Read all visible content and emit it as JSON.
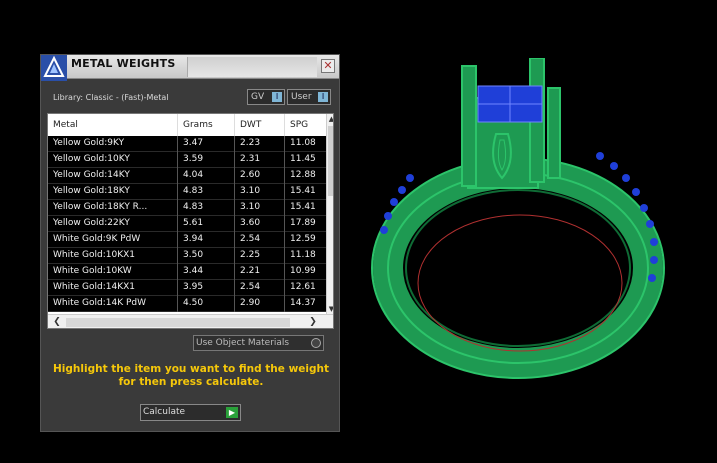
{
  "panel": {
    "title": "METAL WEIGHTS",
    "close_glyph": "✕",
    "library": "Library: Classic - (Fast)-Metal",
    "gv_label": "GV",
    "user_label": "User",
    "indicator_glyph": "I",
    "columns": [
      "Metal",
      "Grams",
      "DWT",
      "SPG"
    ],
    "rows": [
      [
        "Yellow Gold:9KY",
        "3.47",
        "2.23",
        "11.08"
      ],
      [
        "Yellow Gold:10KY",
        "3.59",
        "2.31",
        "11.45"
      ],
      [
        "Yellow Gold:14KY",
        "4.04",
        "2.60",
        "12.88"
      ],
      [
        "Yellow Gold:18KY",
        "4.83",
        "3.10",
        "15.41"
      ],
      [
        "Yellow Gold:18KY R...",
        "4.83",
        "3.10",
        "15.41"
      ],
      [
        "Yellow Gold:22KY",
        "5.61",
        "3.60",
        "17.89"
      ],
      [
        "White Gold:9K PdW",
        "3.94",
        "2.54",
        "12.59"
      ],
      [
        "White Gold:10KX1",
        "3.50",
        "2.25",
        "11.18"
      ],
      [
        "White Gold:10KW",
        "3.44",
        "2.21",
        "10.99"
      ],
      [
        "White Gold:14KX1",
        "3.95",
        "2.54",
        "12.61"
      ],
      [
        "White Gold:14K PdW",
        "4.50",
        "2.90",
        "14.37"
      ]
    ],
    "scroll_up": "▲",
    "scroll_down": "▼",
    "scroll_left": "❮",
    "scroll_right": "❯",
    "use_object_materials": "Use Object Materials",
    "instruction": "Highlight the item you want to find the weight for then press calculate.",
    "calculate_label": "Calculate",
    "calculate_glyph": "▶"
  },
  "colors": {
    "instruction": "#f6c80a",
    "metal_green": "#1e9a52",
    "stone_blue": "#1f3fd8"
  },
  "icons": {
    "title": "app-logo-icon",
    "close": "close-icon",
    "calculate": "play-icon"
  }
}
